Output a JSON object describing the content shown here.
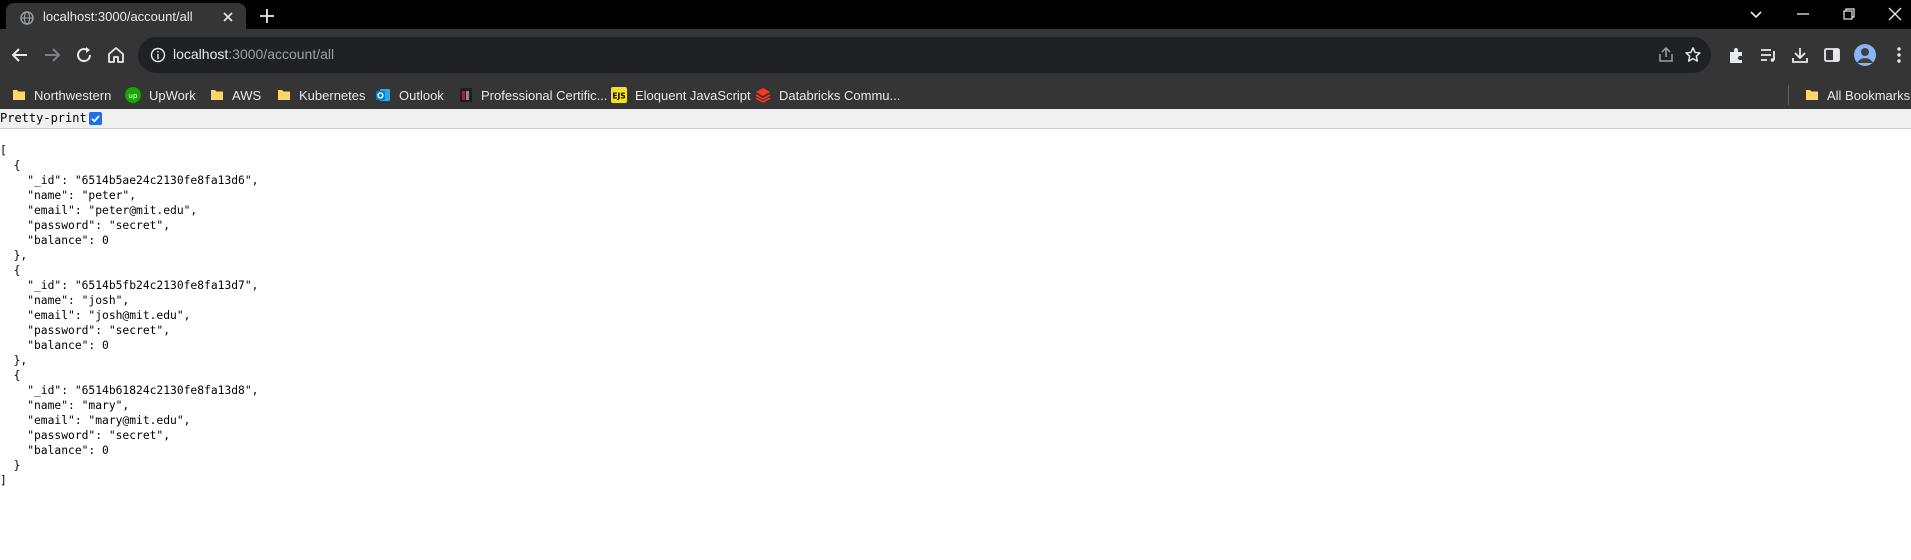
{
  "browser": {
    "tab": {
      "title": "localhost:3000/account/all"
    },
    "address_bar": {
      "host": "localhost",
      "path": ":3000/account/all"
    },
    "bookmarks": [
      {
        "label": "Northwestern",
        "icon": "folder-icon"
      },
      {
        "label": "UpWork",
        "icon": "upwork-icon"
      },
      {
        "label": "AWS",
        "icon": "folder-icon"
      },
      {
        "label": "Kubernetes",
        "icon": "folder-icon"
      },
      {
        "label": "Outlook",
        "icon": "outlook-icon"
      },
      {
        "label": "Professional Certific...",
        "icon": "professional-cert-icon"
      },
      {
        "label": "Eloquent JavaScript",
        "icon": "ejs-icon"
      },
      {
        "label": "Databricks Commu...",
        "icon": "databricks-icon"
      }
    ],
    "all_bookmarks": "All Bookmarks"
  },
  "viewer": {
    "pretty_print_label": "Pretty-print",
    "pretty_print_checked": true
  },
  "json_lines": [
    "[",
    "  {",
    "    \"_id\": \"6514b5ae24c2130fe8fa13d6\",",
    "    \"name\": \"peter\",",
    "    \"email\": \"peter@mit.edu\",",
    "    \"password\": \"secret\",",
    "    \"balance\": 0",
    "  },",
    "  {",
    "    \"_id\": \"6514b5fb24c2130fe8fa13d7\",",
    "    \"name\": \"josh\",",
    "    \"email\": \"josh@mit.edu\",",
    "    \"password\": \"secret\",",
    "    \"balance\": 0",
    "  },",
    "  {",
    "    \"_id\": \"6514b61824c2130fe8fa13d8\",",
    "    \"name\": \"mary\",",
    "    \"email\": \"mary@mit.edu\",",
    "    \"password\": \"secret\",",
    "    \"balance\": 0",
    "  }",
    "]"
  ],
  "colors": {
    "tabstrip": "#000000",
    "toolbar": "#353535",
    "omnibox": "#202124",
    "accent": "#1a73e8",
    "text_light": "#e8eaed"
  }
}
